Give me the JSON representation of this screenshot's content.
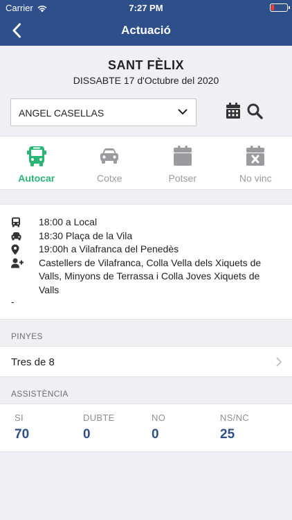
{
  "status_bar": {
    "carrier": "Carrier",
    "time": "7:27 PM"
  },
  "nav": {
    "title": "Actuació",
    "back_icon": "chevron-left-icon"
  },
  "event": {
    "name": "SANT FÈLIX",
    "date": "DISSABTE 17 d'Octubre del 2020"
  },
  "person_select": {
    "value": "ANGEL CASELLAS"
  },
  "tabs": [
    {
      "label": "Autocar",
      "icon": "bus-icon",
      "active": true
    },
    {
      "label": "Cotxe",
      "icon": "car-icon",
      "active": false
    },
    {
      "label": "Potser",
      "icon": "calendar-icon",
      "active": false
    },
    {
      "label": "No vinc",
      "icon": "calendar-x-icon",
      "active": false
    }
  ],
  "details": {
    "bus": "18:00 a Local",
    "car": "18:30 Plaça de la Vila",
    "location": "19:00h a Vilafranca del Penedès",
    "groups": "Castellers de Vilafranca, Colla Vella dels Xiquets de Valls, Minyons de Terrassa i Colla Joves Xiquets de Valls",
    "notes": "-"
  },
  "pinyes": {
    "header": "PINYES",
    "item": "Tres de 8"
  },
  "attendance": {
    "header": "ASSISTÈNCIA",
    "stats": [
      {
        "label": "SI",
        "value": "70"
      },
      {
        "label": "DUBTE",
        "value": "0"
      },
      {
        "label": "NO",
        "value": "0"
      },
      {
        "label": "NS/NC",
        "value": "25"
      }
    ]
  },
  "colors": {
    "brand": "#2e4f8a",
    "active": "#2bb575",
    "inactive": "#9a9a9f",
    "battery_low": "#ff3b30"
  }
}
